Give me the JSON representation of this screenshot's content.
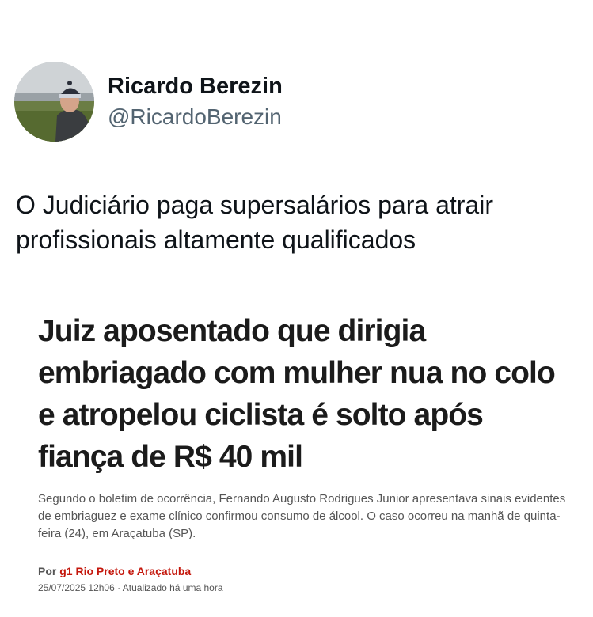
{
  "author": {
    "display_name": "Ricardo Berezin",
    "handle": "@RicardoBerezin"
  },
  "tweet": {
    "text": "O Judiciário paga supersalários para atrair profissionais altamente qualificados"
  },
  "article": {
    "headline": "Juiz aposentado que dirigia embriagado com mulher nua no colo e atropelou ciclista é solto após fiança de R$ 40 mil",
    "summary": "Segundo o boletim de ocorrência, Fernando Augusto Rodrigues Junior apresentava sinais evidentes de embriaguez e exame clínico confirmou consumo de álcool. O caso ocorreu na manhã de quinta-feira (24), em Araçatuba (SP).",
    "byline_prefix": "Por ",
    "byline_source": "g1 Rio Preto e Araçatuba",
    "timestamp": "25/07/2025 12h06 · Atualizado há uma hora"
  },
  "colors": {
    "source_red": "#c4170c",
    "handle_gray": "#536471"
  }
}
